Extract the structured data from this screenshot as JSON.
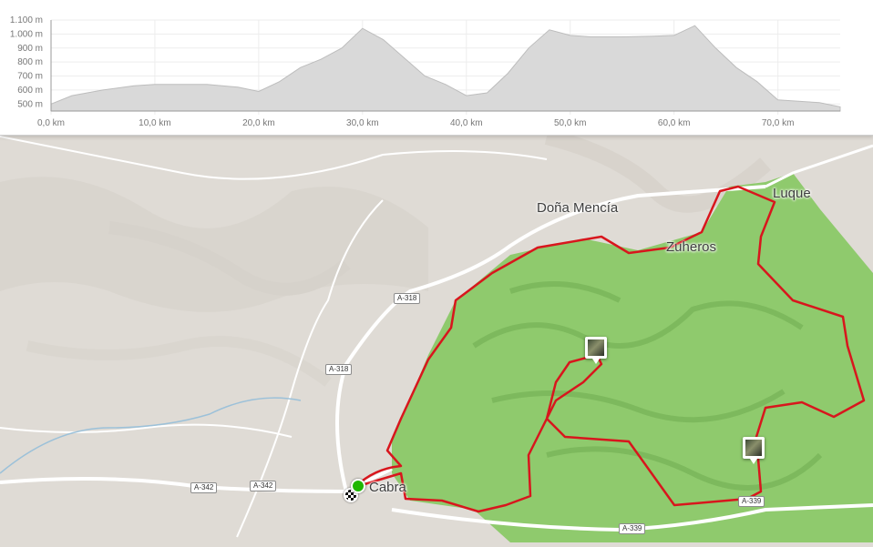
{
  "elevation_profile": {
    "y_axis_labels": [
      "1.100 m",
      "1.000 m",
      "900 m",
      "800 m",
      "700 m",
      "600 m",
      "500 m"
    ],
    "x_axis_labels": [
      "0,0 km",
      "10,0 km",
      "20,0 km",
      "30,0 km",
      "40,0 km",
      "50,0 km",
      "60,0 km",
      "70,0 km"
    ],
    "fill_color": "#d9d9d9",
    "stroke_color": "#bdbdbd"
  },
  "chart_data": {
    "type": "area",
    "x_unit": "km",
    "y_unit": "m",
    "xlim": [
      0,
      76
    ],
    "ylim": [
      450,
      1100
    ],
    "x": [
      0,
      2,
      5,
      8,
      10,
      12,
      15,
      18,
      20,
      22,
      24,
      26,
      28,
      30,
      32,
      34,
      36,
      38,
      40,
      42,
      44,
      46,
      48,
      50,
      52,
      55,
      58,
      60,
      62,
      64,
      66,
      68,
      70,
      72,
      74,
      76
    ],
    "y": [
      500,
      560,
      600,
      630,
      640,
      640,
      640,
      620,
      590,
      660,
      760,
      820,
      900,
      1040,
      960,
      830,
      700,
      640,
      560,
      580,
      720,
      900,
      1030,
      990,
      980,
      980,
      985,
      990,
      1060,
      900,
      760,
      660,
      530,
      520,
      510,
      480
    ]
  },
  "map": {
    "places": {
      "dona_mencia": "Doña Mencía",
      "zuheros": "Zuheros",
      "luque": "Luque",
      "cabra": "Cabra"
    },
    "roads": {
      "a318_a": "A-318",
      "a318_b": "A-318",
      "a342_a": "A-342",
      "a342_b": "A-342",
      "a339_a": "A-339",
      "a339_b": "A-339"
    },
    "route_color": "#d8161d",
    "park_color": "#8fca6d",
    "base_color": "#dfdbd5"
  },
  "markers": {
    "start": "start-marker",
    "finish": "finish-marker",
    "photos": [
      "photo-marker",
      "photo-marker"
    ]
  }
}
